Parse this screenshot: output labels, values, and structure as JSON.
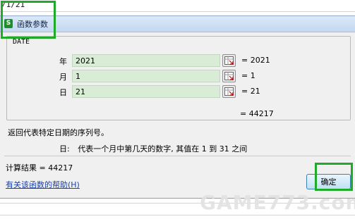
{
  "sheet": {
    "cell_text": "/1/21"
  },
  "dialog": {
    "title": "函数参数",
    "function_name": "DATE",
    "args": [
      {
        "label": "年",
        "value": "2021",
        "result": "= 2021"
      },
      {
        "label": "月",
        "value": "1",
        "result": "= 1"
      },
      {
        "label": "日",
        "value": "21",
        "result": "= 21"
      }
    ],
    "formula_result": "= 44217",
    "description": "返回代表特定日期的序列号。",
    "arg_description_label": "日:",
    "arg_description_text": "代表一个月中第几天的数字, 其值在 1 到 31 之间",
    "calc_result": "计算结果 = 44217",
    "help_link": "有关该函数的帮助(H)",
    "ok_button": "确定"
  },
  "watermark": {
    "text": "GAME773.com"
  },
  "colors": {
    "highlight": "#1faa2a",
    "input_bg": "#d8ecd6",
    "link": "#1a3fa8"
  }
}
